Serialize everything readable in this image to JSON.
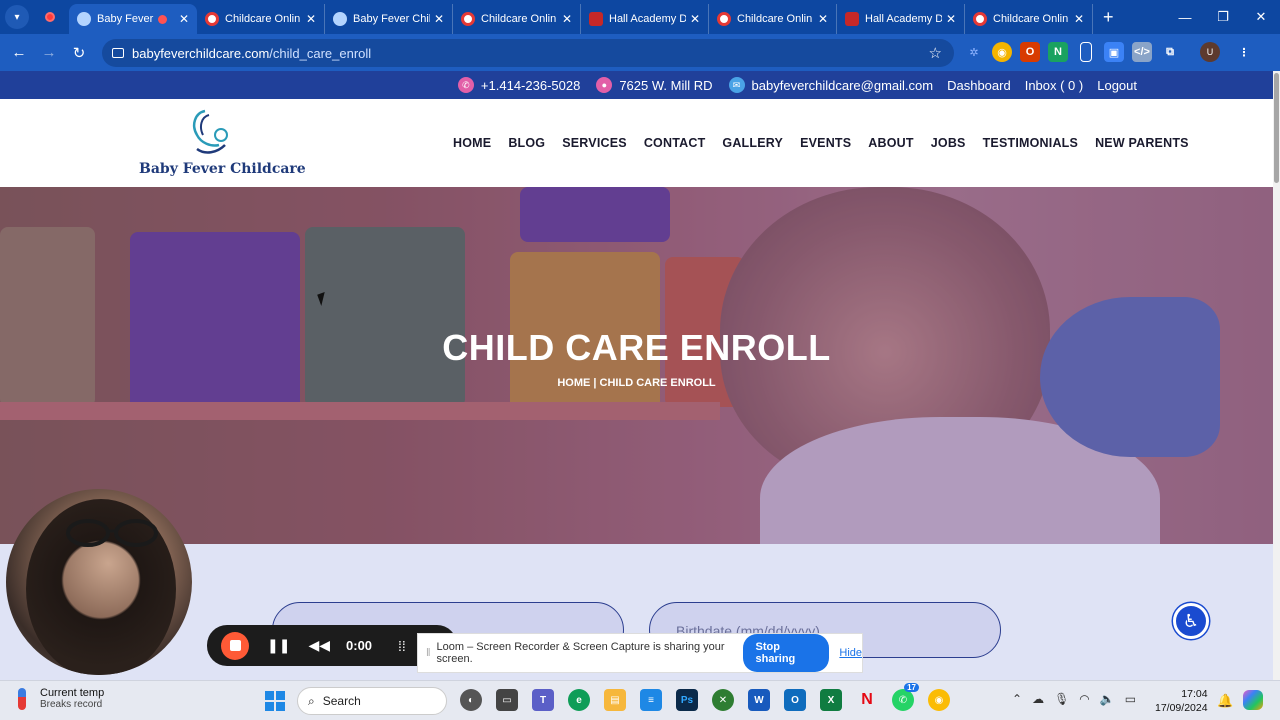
{
  "browser": {
    "tabs": [
      {
        "title": "Baby Fever",
        "icon": "baby-icon",
        "active": true,
        "recording": true
      },
      {
        "title": "Childcare Onlin",
        "icon": "childcare-icon"
      },
      {
        "title": "Baby Fever Chil",
        "icon": "baby-icon"
      },
      {
        "title": "Childcare Onlin",
        "icon": "childcare-icon"
      },
      {
        "title": "Hall Academy D",
        "icon": "hall-icon"
      },
      {
        "title": "Childcare Onlin",
        "icon": "childcare-icon"
      },
      {
        "title": "Hall Academy D",
        "icon": "hall-icon"
      },
      {
        "title": "Childcare Onlin",
        "icon": "childcare-icon"
      }
    ],
    "url_host": "babyfeverchildcare.com",
    "url_path": "/child_care_enroll",
    "profile_initial": "U",
    "accent": "#1e5dc0"
  },
  "topbar": {
    "phone": "+1.414-236-5028",
    "address": "7625 W. Mill RD",
    "email": "babyfeverchildcare@gmail.com",
    "dashboard": "Dashboard",
    "inbox": "Inbox ( 0 )",
    "logout": "Logout",
    "bg": "#20409a"
  },
  "header": {
    "logo_text": "Baby Fever Childcare",
    "nav": [
      "HOME",
      "BLOG",
      "SERVICES",
      "CONTACT",
      "GALLERY",
      "EVENTS",
      "ABOUT",
      "JOBS",
      "TESTIMONIALS",
      "NEW PARENTS"
    ]
  },
  "hero": {
    "title": "CHILD CARE ENROLL",
    "breadcrumb": "HOME | CHILD CARE ENROLL"
  },
  "form": {
    "field1_placeholder": "",
    "field2_placeholder": "Birthdate (mm/dd/yyyy)"
  },
  "loom": {
    "time": "0:00",
    "share_message": "Loom – Screen Recorder & Screen Capture is sharing your screen.",
    "stop_label": "Stop sharing",
    "hide_label": "Hide"
  },
  "taskbar": {
    "weather_title": "Current temp",
    "weather_sub": "Breaks record",
    "search_label": "Search",
    "teams_badge": "17",
    "time": "17:04",
    "date": "17/09/2024"
  }
}
